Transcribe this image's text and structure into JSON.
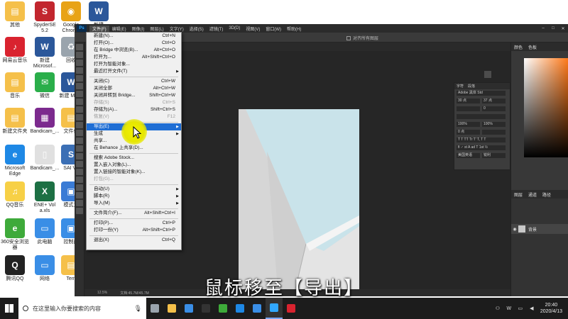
{
  "desktop_icons": [
    {
      "label": "其他",
      "color": "#f5c04a",
      "glyph": "▤"
    },
    {
      "label": "SpyderSE 5.2",
      "color": "#c2262e",
      "glyph": "S"
    },
    {
      "label": "Google Chrome",
      "color": "#e8a317",
      "glyph": "◉"
    },
    {
      "label": "新建",
      "color": "#2b579a",
      "glyph": "W"
    },
    {
      "label": "网易云音乐",
      "color": "#d9232f",
      "glyph": "♪"
    },
    {
      "label": "新建 Microsof...",
      "color": "#2b579a",
      "glyph": "W"
    },
    {
      "label": "回收",
      "color": "#9aa4ad",
      "glyph": "♻"
    },
    {
      "label": "音乐",
      "color": "#f5c04a",
      "glyph": "▤"
    },
    {
      "label": "微信",
      "color": "#2aae4a",
      "glyph": "✉"
    },
    {
      "label": "新建 Micro",
      "color": "#2b579a",
      "glyph": "W"
    },
    {
      "label": "新建文件夹",
      "color": "#f5c04a",
      "glyph": "▤"
    },
    {
      "label": "Bandicam_...",
      "color": "#7c2a8e",
      "glyph": "▦"
    },
    {
      "label": "文件保",
      "color": "#f5c04a",
      "glyph": "▤"
    },
    {
      "label": "Microsoft Edge",
      "color": "#1e88e5",
      "glyph": "e"
    },
    {
      "label": "Bandicam_...",
      "color": "#e0e0e0",
      "glyph": "▯"
    },
    {
      "label": "SAI Vo",
      "color": "#3b6fb5",
      "glyph": "S"
    },
    {
      "label": "QQ音乐",
      "color": "#f7d046",
      "glyph": "♫"
    },
    {
      "label": "ENE+ Vol a.xls",
      "color": "#1d7044",
      "glyph": "X"
    },
    {
      "label": "模式工",
      "color": "#3a7bd5",
      "glyph": "▣"
    },
    {
      "label": "360安全浏览器",
      "color": "#3eaa3a",
      "glyph": "e"
    },
    {
      "label": "此电脑",
      "color": "#3a8ee6",
      "glyph": "▭"
    },
    {
      "label": "控制面",
      "color": "#3a8ee6",
      "glyph": "▣"
    },
    {
      "label": "腾讯QQ",
      "color": "#222222",
      "glyph": "Q"
    },
    {
      "label": "网络",
      "color": "#3a8ee6",
      "glyph": "▭"
    },
    {
      "label": "Tem",
      "color": "#f5c04a",
      "glyph": "▤"
    }
  ],
  "photoshop": {
    "logo": "Ps",
    "menubar": [
      "文件(F)",
      "编辑(E)",
      "图像(I)",
      "图层(L)",
      "文字(Y)",
      "选择(S)",
      "滤镜(T)",
      "3D(D)",
      "视图(V)",
      "窗口(W)",
      "帮助(H)"
    ],
    "options_checkbox_label": "对齐所有图层",
    "status_zoom": "12.5%",
    "status_doc": "文档:45.7M/45.7M",
    "right_tabs": [
      "颜色",
      "色板"
    ],
    "layers_tabs": [
      "图层",
      "通道",
      "路径"
    ],
    "layer_name": "背景",
    "char_panel": {
      "tabs": [
        "字符",
        "段落"
      ],
      "font": "Adobe 黑体 Std",
      "size": "30 点",
      "leading": "37 点",
      "tracking": "0",
      "vscale": "100%",
      "hscale": "100%",
      "baseline": "0 点",
      "lang": "美国英语",
      "aa": "锐利"
    }
  },
  "file_menu": {
    "items": [
      {
        "label": "新建(N)...",
        "shortcut": "Ctrl+N"
      },
      {
        "label": "打开(O)...",
        "shortcut": "Ctrl+O"
      },
      {
        "label": "在 Bridge 中浏览(B)...",
        "shortcut": "Alt+Ctrl+O"
      },
      {
        "label": "打开为...",
        "shortcut": "Alt+Shift+Ctrl+O"
      },
      {
        "label": "打开为智能对象...",
        "shortcut": ""
      },
      {
        "label": "最近打开文件(T)",
        "shortcut": "",
        "submenu": true
      },
      {
        "sep": true
      },
      {
        "label": "关闭(C)",
        "shortcut": "Ctrl+W"
      },
      {
        "label": "关闭全部",
        "shortcut": "Alt+Ctrl+W"
      },
      {
        "label": "关闭并转到 Bridge...",
        "shortcut": "Shift+Ctrl+W"
      },
      {
        "label": "存储(S)",
        "shortcut": "Ctrl+S",
        "disabled": true
      },
      {
        "label": "存储为(A)...",
        "shortcut": "Shift+Ctrl+S"
      },
      {
        "label": "恢复(V)",
        "shortcut": "F12",
        "disabled": true
      },
      {
        "sep": true
      },
      {
        "label": "导出(E)",
        "shortcut": "",
        "submenu": true,
        "highlight": true
      },
      {
        "label": "生成",
        "shortcut": "",
        "submenu": true
      },
      {
        "label": "共享...",
        "shortcut": ""
      },
      {
        "label": "在 Behance 上共享(D)...",
        "shortcut": ""
      },
      {
        "sep": true
      },
      {
        "label": "搜索 Adobe Stock...",
        "shortcut": ""
      },
      {
        "label": "置入嵌入对象(L)...",
        "shortcut": ""
      },
      {
        "label": "置入链接的智能对象(K)...",
        "shortcut": ""
      },
      {
        "label": "打包(G)...",
        "shortcut": "",
        "disabled": true
      },
      {
        "sep": true
      },
      {
        "label": "自动(U)",
        "shortcut": "",
        "submenu": true
      },
      {
        "label": "脚本(R)",
        "shortcut": "",
        "submenu": true
      },
      {
        "label": "导入(M)",
        "shortcut": "",
        "submenu": true
      },
      {
        "sep": true
      },
      {
        "label": "文件简介(F)...",
        "shortcut": "Alt+Shift+Ctrl+I"
      },
      {
        "sep": true
      },
      {
        "label": "打印(P)...",
        "shortcut": "Ctrl+P"
      },
      {
        "label": "打印一份(Y)",
        "shortcut": "Alt+Shift+Ctrl+P"
      },
      {
        "sep": true
      },
      {
        "label": "退出(X)",
        "shortcut": "Ctrl+Q"
      }
    ]
  },
  "subtitle": "鼠标移至【导出】",
  "taskbar": {
    "search_placeholder": "在这里输入你要搜索的内容",
    "apps": [
      {
        "name": "task-view",
        "color": "#9aa4ad"
      },
      {
        "name": "file-explorer",
        "color": "#f5c04a"
      },
      {
        "name": "mail",
        "color": "#3a8ee6"
      },
      {
        "name": "qq",
        "color": "#333333"
      },
      {
        "name": "360",
        "color": "#3eaa3a"
      },
      {
        "name": "edge",
        "color": "#1e88e5"
      },
      {
        "name": "store",
        "color": "#3a8ee6"
      },
      {
        "name": "photoshop",
        "color": "#31a8ff",
        "active": true
      },
      {
        "name": "bandicam",
        "color": "#d9232f"
      }
    ],
    "time": "20:40",
    "date": "2020/4/13"
  }
}
